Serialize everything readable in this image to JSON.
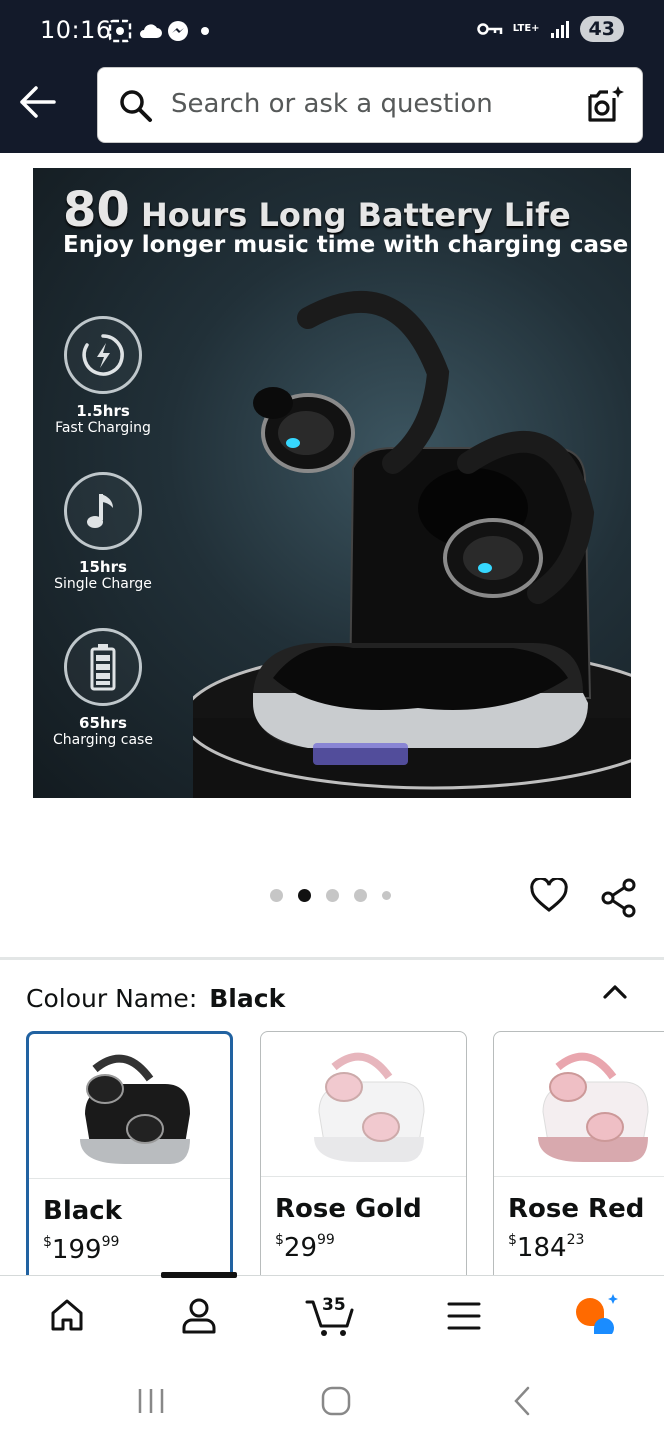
{
  "status_bar": {
    "time": "10:16",
    "network": "LTE+",
    "battery": "43"
  },
  "search": {
    "placeholder": "Search or ask a question"
  },
  "hero": {
    "headline_num": "80",
    "headline_text": " Hours Long Battery Life",
    "subheadline": "Enjoy longer music time with charging case",
    "features": [
      {
        "value": "1.5hrs",
        "label": "Fast Charging"
      },
      {
        "value": "15hrs",
        "label": "Single Charge"
      },
      {
        "value": "65hrs",
        "label": "Charging case"
      }
    ],
    "carousel": {
      "count": 5,
      "active_index": 1
    }
  },
  "variation": {
    "label": "Colour Name:",
    "selected": "Black",
    "options": [
      {
        "name": "Black",
        "currency": "$",
        "whole": "199",
        "fraction": "99",
        "selected": true
      },
      {
        "name": "Rose Gold",
        "currency": "$",
        "whole": "29",
        "fraction": "99",
        "selected": false
      },
      {
        "name": "Rose Red",
        "currency": "$",
        "whole": "184",
        "fraction": "23",
        "selected": false
      }
    ]
  },
  "bottom_nav": {
    "cart_count": "35",
    "active": "account",
    "items": [
      "home",
      "account",
      "cart",
      "menu",
      "rufus-ai"
    ]
  },
  "colors": {
    "header_bg": "#131a2a",
    "selected_border": "#2162a1",
    "ai_orange": "#ff6a00",
    "ai_blue": "#1a8cff"
  }
}
